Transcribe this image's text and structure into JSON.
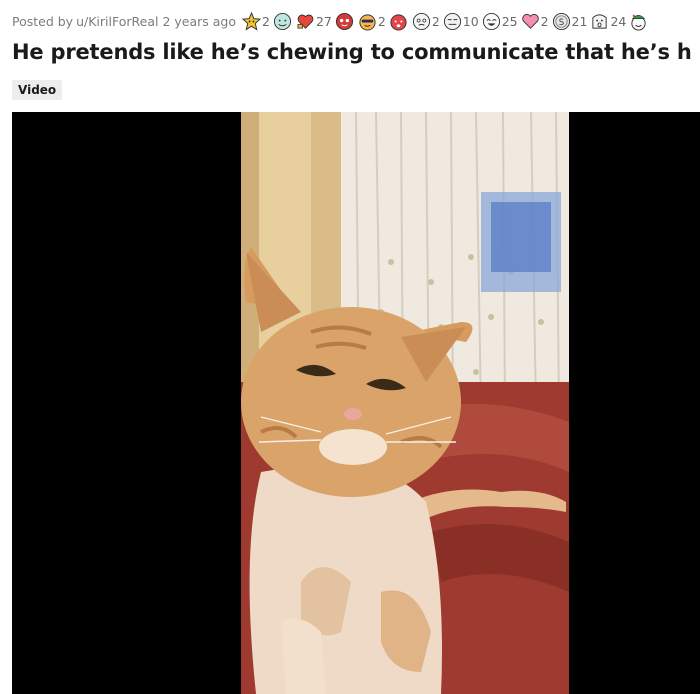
{
  "post": {
    "posted_by_prefix": "Posted by",
    "author": "u/KirilForReal",
    "age": "2 years ago",
    "title": "He pretends like he’s chewing to communicate that he’s hungry!",
    "flair": "Video"
  },
  "awards": [
    {
      "icon": "star-face-award-icon",
      "count": "2"
    },
    {
      "icon": "blue-face-award-icon",
      "count": ""
    },
    {
      "icon": "heart-pin-award-icon",
      "count": "27"
    },
    {
      "icon": "heart-eyes-award-icon",
      "count": ""
    },
    {
      "icon": "cool-face-award-icon",
      "count": "2"
    },
    {
      "icon": "red-face-award-icon",
      "count": ""
    },
    {
      "icon": "crying-face-award-icon",
      "count": "2"
    },
    {
      "icon": "sweaty-face-award-icon",
      "count": "10"
    },
    {
      "icon": "laughing-face-award-icon",
      "count": "25"
    },
    {
      "icon": "pink-heart-award-icon",
      "count": "2"
    },
    {
      "icon": "silver-coin-award-icon",
      "count": "21"
    },
    {
      "icon": "shocked-face-award-icon",
      "count": "24"
    },
    {
      "icon": "party-face-award-icon",
      "count": ""
    }
  ],
  "colors": {
    "meta_text": "#7c7c7c",
    "title_text": "#1a1a1b",
    "flair_bg": "#ededed",
    "video_bg": "#000000",
    "bedspread": "#9e3a2f",
    "cat_fur": "#d9a36a"
  }
}
